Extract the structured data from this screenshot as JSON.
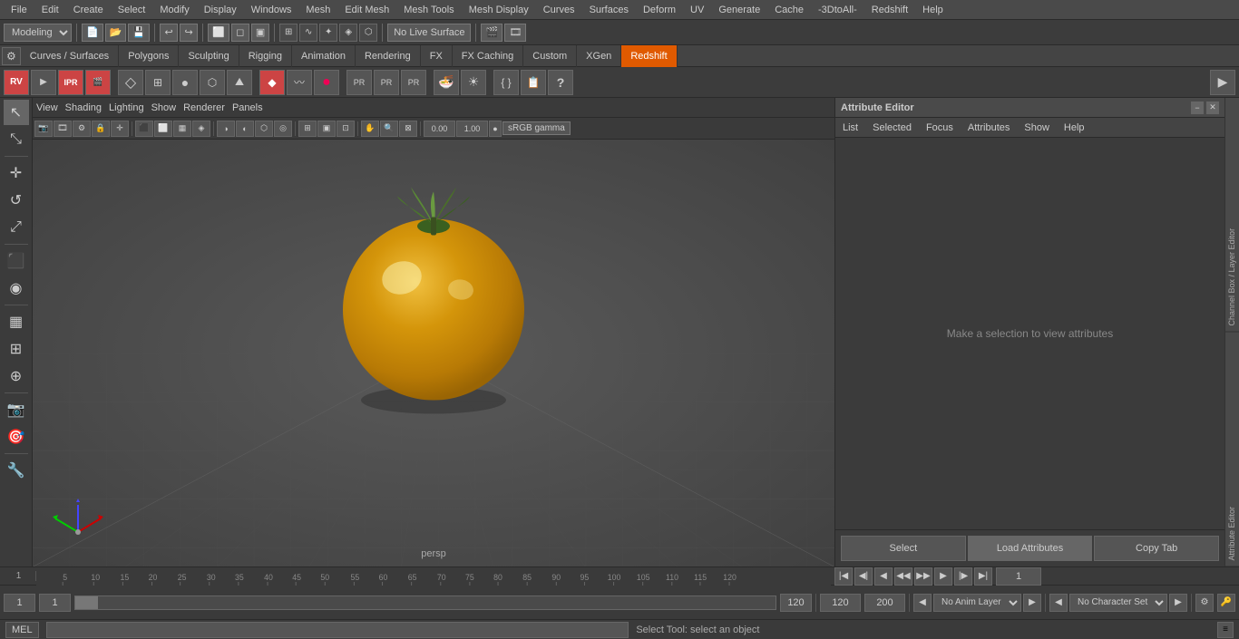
{
  "menubar": {
    "items": [
      "File",
      "Edit",
      "Create",
      "Select",
      "Modify",
      "Display",
      "Windows",
      "Mesh",
      "Edit Mesh",
      "Mesh Tools",
      "Mesh Display",
      "Curves",
      "Surfaces",
      "Deform",
      "UV",
      "Generate",
      "Cache",
      "-3DtoAll-",
      "Redshift",
      "Help"
    ]
  },
  "toolbar1": {
    "workspace_dropdown": "Modeling",
    "live_surface": "No Live Surface"
  },
  "shelf_tabs": [
    {
      "id": "curves-surfaces",
      "label": "Curves / Surfaces",
      "active": false
    },
    {
      "id": "polygons",
      "label": "Polygons",
      "active": false
    },
    {
      "id": "sculpting",
      "label": "Sculpting",
      "active": false
    },
    {
      "id": "rigging",
      "label": "Rigging",
      "active": false
    },
    {
      "id": "animation",
      "label": "Animation",
      "active": false
    },
    {
      "id": "rendering",
      "label": "Rendering",
      "active": false
    },
    {
      "id": "fx",
      "label": "FX",
      "active": false
    },
    {
      "id": "fx-caching",
      "label": "FX Caching",
      "active": false
    },
    {
      "id": "custom",
      "label": "Custom",
      "active": false
    },
    {
      "id": "xgen",
      "label": "XGen",
      "active": false
    },
    {
      "id": "redshift",
      "label": "Redshift",
      "active": true
    }
  ],
  "viewport": {
    "menu_items": [
      "View",
      "Shading",
      "Lighting",
      "Show",
      "Renderer",
      "Panels"
    ],
    "label": "persp",
    "gamma": "sRGB gamma",
    "value1": "0.00",
    "value2": "1.00"
  },
  "attribute_editor": {
    "title": "Attribute Editor",
    "tabs": [
      "List",
      "Selected",
      "Focus",
      "Attributes",
      "Show",
      "Help"
    ],
    "empty_message": "Make a selection to view attributes",
    "footer_buttons": [
      "Select",
      "Load Attributes",
      "Copy Tab"
    ]
  },
  "side_labels": {
    "channel_box": "Channel Box / Layer Editor",
    "attribute_editor": "Attribute Editor"
  },
  "timeline": {
    "start": "1",
    "end": "120",
    "current": "1",
    "range_end": "200",
    "ticks": [
      "5",
      "10",
      "15",
      "20",
      "25",
      "30",
      "35",
      "40",
      "45",
      "50",
      "55",
      "60",
      "65",
      "70",
      "75",
      "80",
      "85",
      "90",
      "95",
      "100",
      "105",
      "110",
      "115",
      "120"
    ],
    "no_anim_layer": "No Anim Layer",
    "no_char_set": "No Character Set"
  },
  "bottom_controls": {
    "frame_start": "1",
    "frame_current": "1",
    "frame_end": "120",
    "anim_end": "200"
  },
  "status_bar": {
    "mode": "MEL",
    "status": "Select Tool: select an object"
  }
}
